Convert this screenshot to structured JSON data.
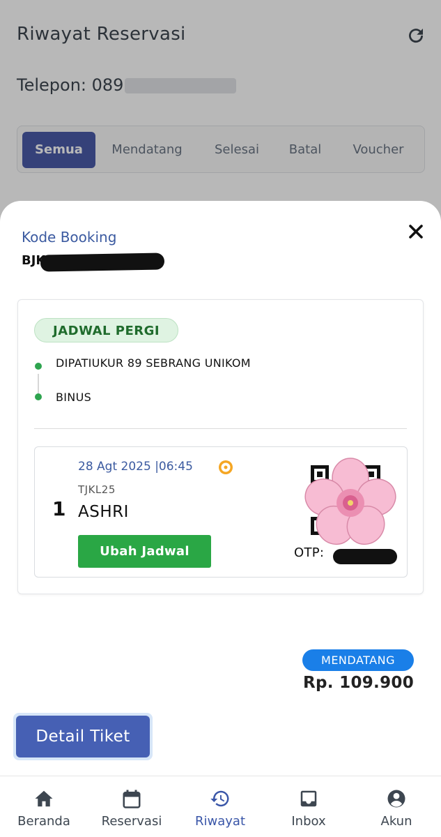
{
  "background": {
    "title": "Riwayat Reservasi",
    "phone_label": "Telepon: 089",
    "tabs": [
      {
        "label": "Semua",
        "active": true
      },
      {
        "label": "Mendatang",
        "active": false
      },
      {
        "label": "Selesai",
        "active": false
      },
      {
        "label": "Batal",
        "active": false
      },
      {
        "label": "Voucher",
        "active": false
      }
    ]
  },
  "sheet": {
    "booking_label": "Kode Booking",
    "booking_code_visible": "BJK",
    "schedule_chip": "JADWAL PERGI",
    "route": {
      "origin": "DIPATIUKUR 89 SEBRANG UNIKOM",
      "destination": "BINUS"
    },
    "ticket": {
      "passenger_number": "1",
      "datetime": "28 Agt 2025 |06:45",
      "code_visible": "TJKL25",
      "passenger_name": "ASHRI",
      "reschedule_button": "Ubah Jadwal",
      "otp_label": "OTP:"
    },
    "status": "MENDATANG",
    "price": "Rp. 109.900",
    "detail_button": "Detail Tiket"
  },
  "nav": {
    "items": [
      {
        "label": "Beranda",
        "icon": "home-icon",
        "active": false
      },
      {
        "label": "Reservasi",
        "icon": "calendar-icon",
        "active": false
      },
      {
        "label": "Riwayat",
        "icon": "history-icon",
        "active": true
      },
      {
        "label": "Inbox",
        "icon": "inbox-icon",
        "active": false
      },
      {
        "label": "Akun",
        "icon": "account-icon",
        "active": false
      }
    ]
  },
  "colors": {
    "primary": "#4660b4",
    "link": "#3b5aa0",
    "success": "#2aa745",
    "status_blue": "#1a7fe8",
    "route_dot": "#2ea44f",
    "clock_orange": "#f5a623"
  }
}
